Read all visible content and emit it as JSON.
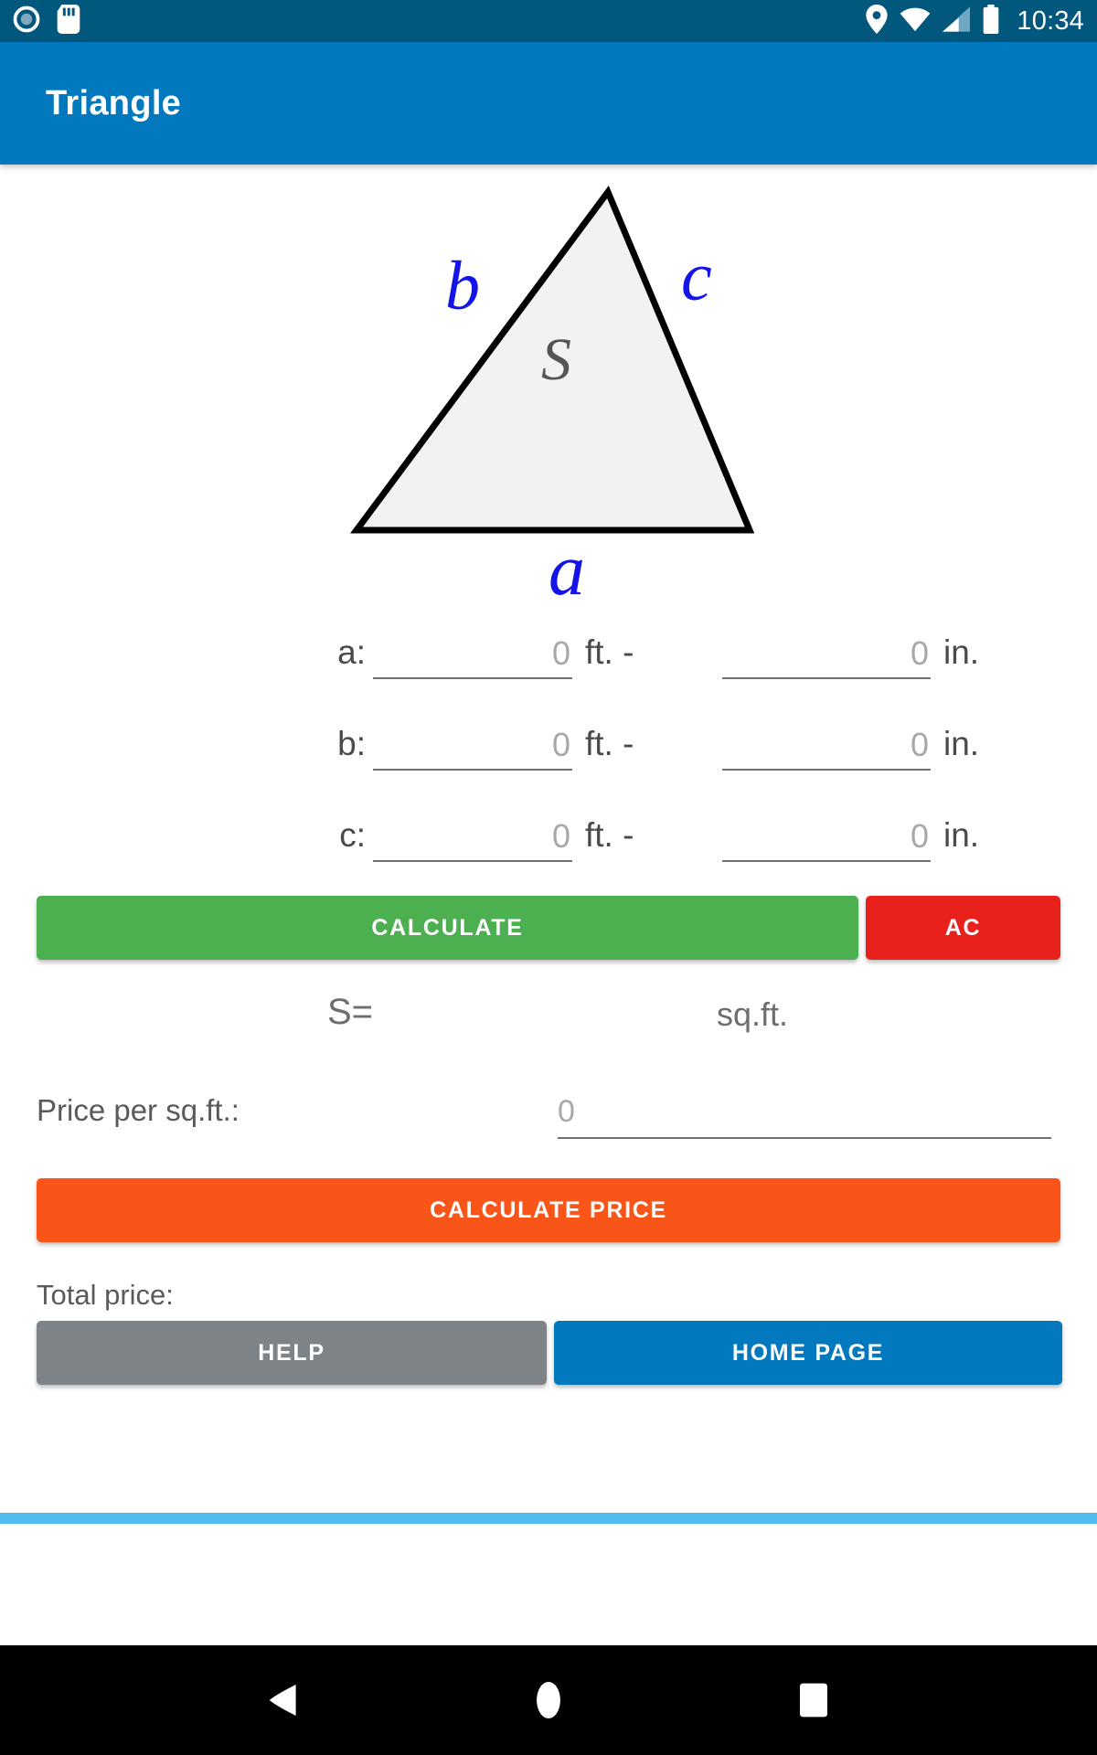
{
  "status_bar": {
    "time": "10:34",
    "icons_left": [
      "screen-record-icon",
      "sd-card-icon"
    ],
    "icons_right": [
      "location-pin-icon",
      "wifi-icon",
      "cellular-signal-icon",
      "battery-icon"
    ],
    "background": "#02577D"
  },
  "app_bar": {
    "title": "Triangle",
    "background": "#0279BE"
  },
  "figure": {
    "label_b": "b",
    "label_c": "c",
    "label_a": "a",
    "label_s": "S",
    "stroke_color": "#000000",
    "fill_color": "#F2F2F2",
    "side_label_color": "#1414E6",
    "area_label_color": "#555555"
  },
  "inputs": {
    "rows": [
      {
        "label": "a:",
        "ft_value": "",
        "ft_placeholder": "0",
        "ft_unit": "ft. -",
        "in_value": "",
        "in_placeholder": "0",
        "in_unit": "in."
      },
      {
        "label": "b:",
        "ft_value": "",
        "ft_placeholder": "0",
        "ft_unit": "ft. -",
        "in_value": "",
        "in_placeholder": "0",
        "in_unit": "in."
      },
      {
        "label": "c:",
        "ft_value": "",
        "ft_placeholder": "0",
        "ft_unit": "ft. -",
        "in_value": "",
        "in_placeholder": "0",
        "in_unit": "in."
      }
    ]
  },
  "buttons": {
    "calculate": "CALCULATE",
    "ac": "AC",
    "calculate_price": "CALCULATE PRICE",
    "help": "HELP",
    "home_page": "HOME PAGE",
    "calculate_color": "#4CAF50",
    "ac_color": "#E8211D",
    "calculate_price_color": "#FA5519",
    "help_color": "#7E8387",
    "home_page_color": "#0279BE"
  },
  "result": {
    "s_label": "S=",
    "s_value": "",
    "s_unit": "sq.ft."
  },
  "price": {
    "label": "Price per sq.ft.:",
    "value": "",
    "placeholder": "0"
  },
  "total": {
    "label": "Total price:",
    "value": ""
  },
  "footer": {
    "divider_color": "#51BCF2"
  },
  "nav_bar": {
    "back": "back-icon",
    "home": "home-icon",
    "recents": "recents-icon"
  }
}
